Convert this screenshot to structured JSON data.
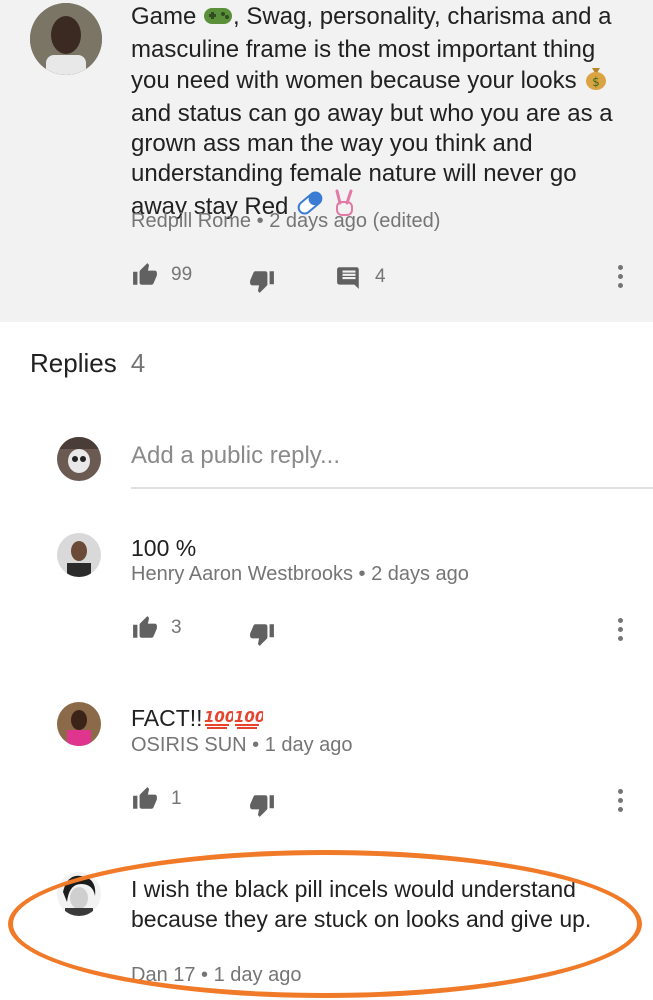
{
  "comment": {
    "text_parts": [
      "Game ",
      ", Swag, personality, charisma and a masculine frame is the most important thing you need with women because your looks ",
      " and status can go away but who you are as a grown ass man the way you think and understanding female nature will never go away  stay Red "
    ],
    "author": "Redpill Rome",
    "time": "2 days ago (edited)",
    "likes": "99",
    "replies_count": "4",
    "icons": [
      "game-controller-icon",
      "money-bag-icon",
      "pill-icon",
      "victory-hand-icon"
    ]
  },
  "replies_section": {
    "title": "Replies",
    "count": "4",
    "input_placeholder": "Add a public reply..."
  },
  "replies": [
    {
      "text": "100 %",
      "author": "Henry Aaron Westbrooks",
      "time": "2 days ago",
      "likes": "3"
    },
    {
      "text": "FACT!!",
      "author": "OSIRIS SUN",
      "time": "1 day ago",
      "likes": "1",
      "icons": [
        "hundred-points-icon",
        "hundred-points-icon"
      ]
    },
    {
      "text": "I wish the black pill incels would understand because they are stuck on looks and give up.",
      "author": "Dan 17",
      "time": "1 day ago"
    }
  ],
  "colors": {
    "highlight_circle": "#f07a28",
    "header_bg": "#f2f2f2",
    "meta": "#757575"
  }
}
